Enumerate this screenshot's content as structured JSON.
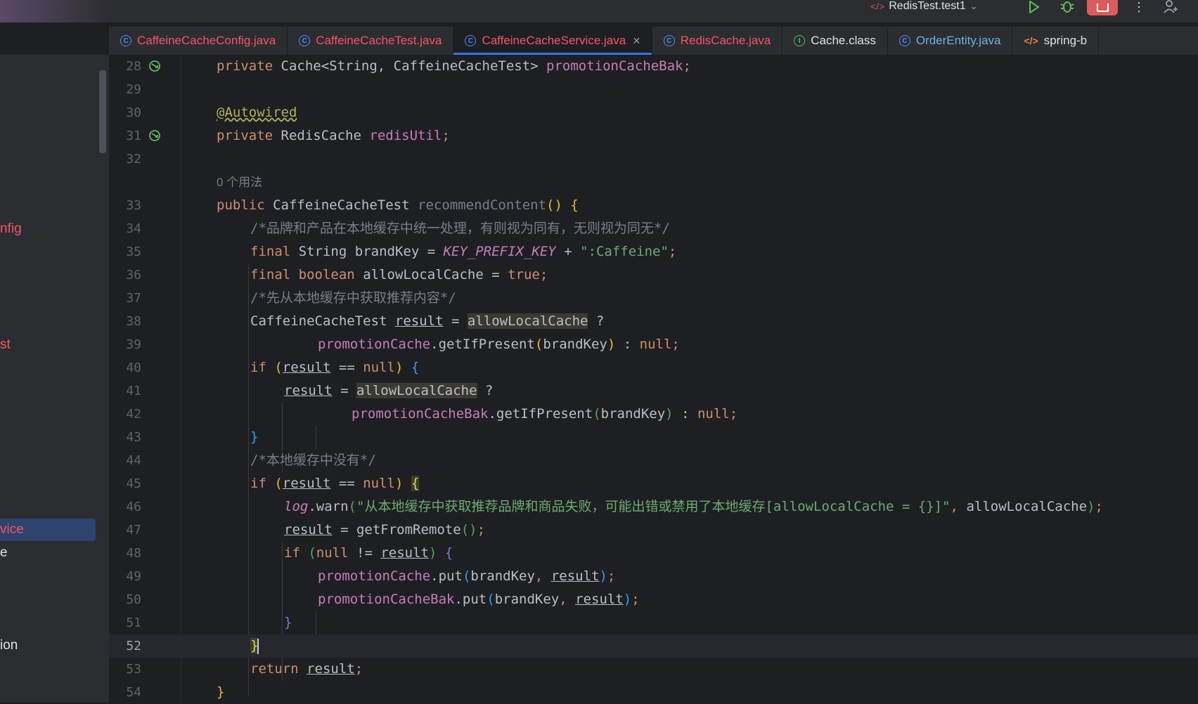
{
  "toolbar": {
    "run_config": "RedisTest.test1",
    "run_icon": "play-icon",
    "debug_icon": "bug-icon",
    "stop_icon": "stop-icon",
    "more_icon": "more-vertical-icon",
    "user_icon": "add-user-icon"
  },
  "tabs": [
    {
      "label": "CaffeineCacheConfig.java",
      "color": "#f75464",
      "icon": "class"
    },
    {
      "label": "CaffeineCacheTest.java",
      "color": "#f75464",
      "icon": "class"
    },
    {
      "label": "CaffeineCacheService.java",
      "color": "#f75464",
      "icon": "class",
      "active": true
    },
    {
      "label": "RedisCache.java",
      "color": "#f75464",
      "icon": "class"
    },
    {
      "label": "Cache.class",
      "color": "#dfe1e5",
      "icon": "interface"
    },
    {
      "label": "OrderEntity.java",
      "color": "#6fb1e8",
      "icon": "class"
    },
    {
      "label": "spring-b",
      "color": "#dfe1e5",
      "icon": "xml"
    }
  ],
  "sidebar": {
    "items": [
      {
        "label": "nfig",
        "color": "#f75464"
      },
      {
        "label": "st",
        "color": "#f75464"
      },
      {
        "label": "vice",
        "color": "#f75464"
      },
      {
        "label": "e",
        "color": "#dfe1e5"
      },
      {
        "label": "ion",
        "color": "#dfe1e5"
      }
    ]
  },
  "editor": {
    "usage_hint": "0 个用法",
    "line_numbers": [
      "28",
      "29",
      "30",
      "31",
      "32",
      "33",
      "34",
      "35",
      "36",
      "37",
      "38",
      "39",
      "40",
      "41",
      "42",
      "43",
      "44",
      "45",
      "46",
      "47",
      "48",
      "49",
      "50",
      "51",
      "52",
      "53",
      "54"
    ],
    "code": {
      "l28_private": "private",
      "l28_type": "Cache<String, CaffeineCacheTest>",
      "l28_field": "promotionCacheBak",
      "l30_ann": "@Autowired",
      "l31_private": "private",
      "l31_type": "RedisCache",
      "l31_field": "redisUtil",
      "l33_public": "public",
      "l33_type": "CaffeineCacheTest",
      "l33_method": "recommendContent",
      "l34_comment": "/*品牌和产品在本地缓存中统一处理，有则视为同有，无则视为同无*/",
      "l35_final": "final",
      "l35_type": "String",
      "l35_var": "brandKey",
      "l35_const": "KEY_PREFIX_KEY",
      "l35_str": "\":Caffeine\"",
      "l36_final": "final",
      "l36_bool": "boolean",
      "l36_var": "allowLocalCache",
      "l36_true": "true",
      "l37_comment": "/*先从本地缓存中获取推荐内容*/",
      "l38_type": "CaffeineCacheTest",
      "l38_var": "result",
      "l38_flag": "allowLocalCache",
      "l39_field": "promotionCache",
      "l39_call": "getIfPresent",
      "l39_arg": "brandKey",
      "l39_null": "null",
      "l40_if": "if",
      "l40_var": "result",
      "l40_null": "null",
      "l41_var": "result",
      "l41_flag": "allowLocalCache",
      "l42_field": "promotionCacheBak",
      "l42_call": "getIfPresent",
      "l42_arg": "brandKey",
      "l42_null": "null",
      "l44_comment": "/*本地缓存中没有*/",
      "l45_if": "if",
      "l45_var": "result",
      "l45_null": "null",
      "l46_log": "log",
      "l46_call": "warn",
      "l46_str": "\"从本地缓存中获取推荐品牌和商品失败，可能出错或禁用了本地缓存[allowLocalCache = {}]\"",
      "l46_arg": "allowLocalCache",
      "l47_var": "result",
      "l47_call": "getFromRemote",
      "l48_if": "if",
      "l48_null": "null",
      "l48_var": "result",
      "l49_field": "promotionCache",
      "l49_call": "put",
      "l49_arg": "brandKey",
      "l49_var": "result",
      "l50_field": "promotionCacheBak",
      "l50_call": "put",
      "l50_arg": "brandKey",
      "l50_var": "result",
      "l53_return": "return",
      "l53_var": "result"
    }
  }
}
